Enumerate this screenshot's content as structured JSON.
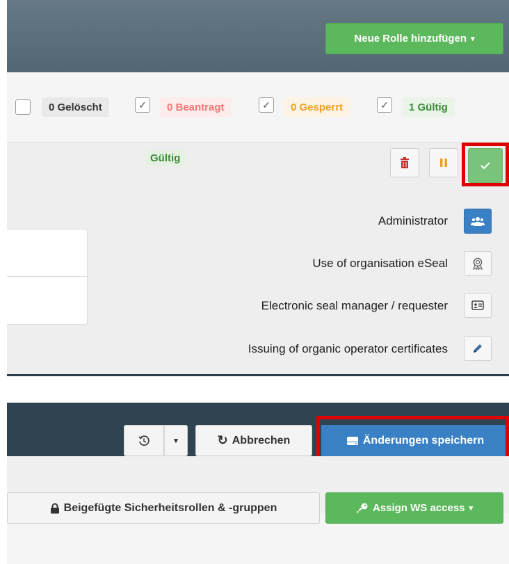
{
  "colors": {
    "header_bg": "#5a6d7a",
    "dark_header_bg": "#2f4350",
    "accent_green": "#5cb85c",
    "accent_blue": "#3a80c4",
    "highlight_red": "#e00000"
  },
  "roles_panel": {
    "add_role_button": "Neue Rolle hinzufügen",
    "filters": [
      {
        "label": "0 Gelöscht",
        "checked": false
      },
      {
        "label": "0 Beantragt",
        "checked": true
      },
      {
        "label": "0 Gesperrt",
        "checked": true
      },
      {
        "label": "1 Gültig",
        "checked": true
      }
    ],
    "role_status": "Gültig",
    "permissions": [
      {
        "label": "Administrator",
        "icon": "users-icon",
        "active": true
      },
      {
        "label": "Use of organisation eSeal",
        "icon": "award-icon",
        "active": false
      },
      {
        "label": "Electronic seal manager / requester",
        "icon": "id-card-icon",
        "active": false
      },
      {
        "label": "Issuing of organic operator certificates",
        "icon": "pencil-icon",
        "active": false
      }
    ]
  },
  "toolbar": {
    "cancel_label": "Abbrechen",
    "save_label": "Änderungen speichern",
    "attached_roles_label": "Beigefügte Sicherheitsrollen & -gruppen",
    "assign_ws_label": "Assign WS access"
  }
}
